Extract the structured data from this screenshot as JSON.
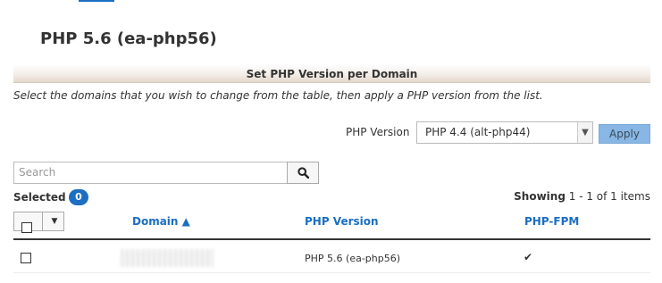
{
  "page": {
    "title": "PHP 5.6 (ea-php56)"
  },
  "section": {
    "header": "Set PHP Version per Domain",
    "instructions": "Select the domains that you wish to change from the table, then apply a PHP version from the list."
  },
  "version_selector": {
    "label": "PHP Version",
    "selected": "PHP 4.4 (alt-php44)",
    "apply_label": "Apply"
  },
  "search": {
    "placeholder": "Search"
  },
  "selection": {
    "label": "Selected",
    "count": "0"
  },
  "paging": {
    "showing_label": "Showing",
    "range": "1 - 1 of 1 items"
  },
  "table": {
    "columns": {
      "domain": "Domain ▲",
      "php_version": "PHP Version",
      "php_fpm": "PHP-FPM"
    },
    "rows": [
      {
        "php_version": "PHP 5.6 (ea-php56)",
        "php_fpm": "✔"
      }
    ]
  },
  "icons": {
    "search": "search-icon",
    "select_caret": "chevron-down-icon",
    "check": "checkmark-icon"
  },
  "colors": {
    "accent": "#1b6ec2",
    "apply_button": "#88b7e5"
  }
}
